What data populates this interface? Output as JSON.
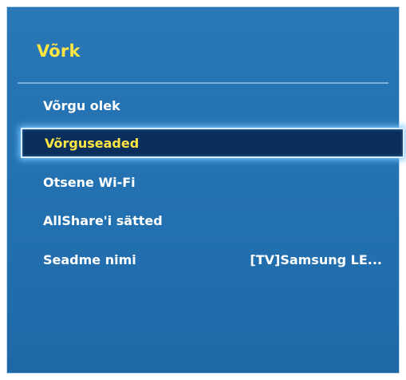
{
  "menu": {
    "title": "Võrk",
    "items": [
      {
        "label": "Võrgu olek",
        "value": null
      },
      {
        "label": "Võrguseaded",
        "value": null
      },
      {
        "label": "Otsene Wi-Fi",
        "value": null
      },
      {
        "label": "AllShare'i sätted",
        "value": null
      },
      {
        "label": "Seadme nimi",
        "value": "[TV]Samsung LE..."
      }
    ],
    "selected_item": "Võrguseaded"
  },
  "colors": {
    "background": "#2674b4",
    "title": "#ffe642",
    "selected_background": "#0b2f5c",
    "selected_text": "#ffe642",
    "text": "#ffffff",
    "focus_glow": "#7cc8ff"
  }
}
